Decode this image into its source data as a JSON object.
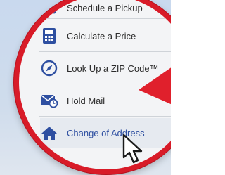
{
  "menu": {
    "items": [
      {
        "label": "Schedule a Pickup",
        "icon": "truck-icon"
      },
      {
        "label": "Calculate a Price",
        "icon": "calculator-icon"
      },
      {
        "label": "Look Up a ZIP Code™",
        "icon": "compass-icon"
      },
      {
        "label": "Hold Mail",
        "icon": "mail-hold-icon"
      },
      {
        "label": "Change of Address",
        "icon": "house-icon"
      }
    ]
  },
  "colors": {
    "lens_border": "#d81b28",
    "icon_blue": "#2e4fa1",
    "highlight_text": "#2e4fa1",
    "red_arrow": "#e0202c"
  }
}
